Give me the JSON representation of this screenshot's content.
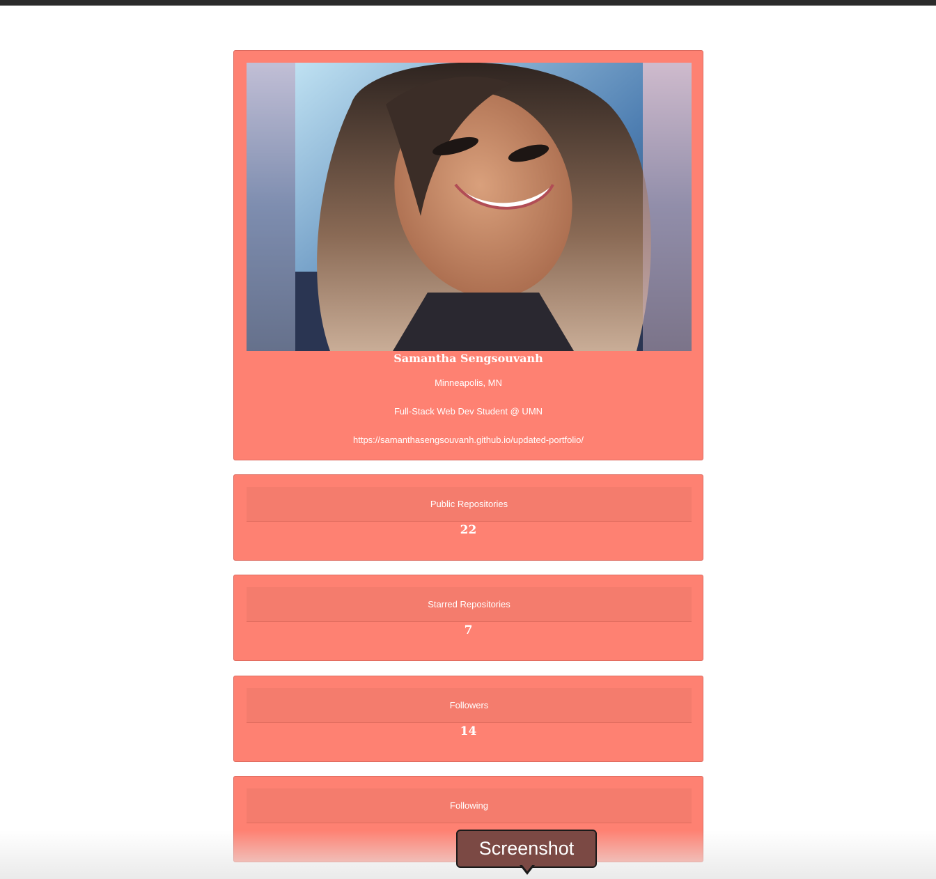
{
  "profile": {
    "name": "Samantha Sengsouvanh",
    "location": "Minneapolis, MN",
    "bio": "Full-Stack Web Dev Student @ UMN",
    "blog": "https://samanthasengsouvanh.github.io/updated-portfolio/"
  },
  "stats": [
    {
      "label": "Public Repositories",
      "value": "22"
    },
    {
      "label": "Starred Repositories",
      "value": "7"
    },
    {
      "label": "Followers",
      "value": "14"
    },
    {
      "label": "Following",
      "value": ""
    }
  ],
  "tooltip": {
    "label": "Screenshot"
  },
  "colors": {
    "card": "#fe8172",
    "card_header": "#f47c6d",
    "tooltip": "#7b4944"
  }
}
